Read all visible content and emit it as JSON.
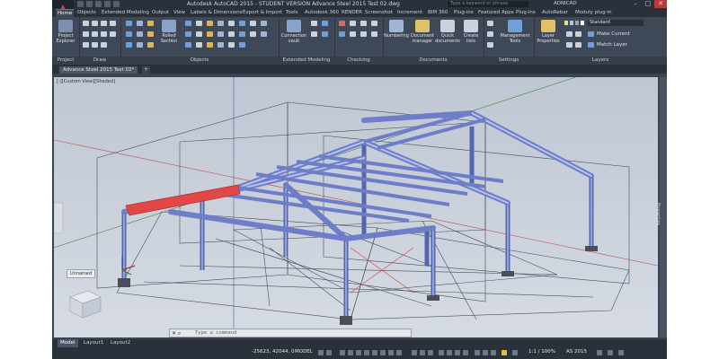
{
  "window": {
    "title": "Autodesk AutoCAD 2015 - STUDENT VERSION   Advance Steel 2015 Test 02.dwg",
    "search_placeholder": "Type a keyword or phrase",
    "user": "ADNICAD"
  },
  "ribbon_tabs": [
    "Home",
    "Objects",
    "Extended Modeling",
    "Output",
    "View",
    "Labels & Dimensions",
    "Export & Import",
    "Tools",
    "Autodesk 360",
    "RENDER",
    "Screenshot",
    "Increment",
    "BIM 360",
    "Plug-ins",
    "Featured Apps",
    "Plug-ins",
    "AutoRebar",
    "Moduly plug-in"
  ],
  "ribbon": {
    "project_explorer": "Project Explorer",
    "project_label": "Project",
    "draw_label": "Draw",
    "rolled_section": "Rolled Section",
    "objects_label": "Objects",
    "connection_vault": "Connection vault",
    "extended_modeling_label": "Extended Modeling",
    "checking_label": "Checking",
    "numbering": "Numbering",
    "document_manager": "Document manager",
    "quick_documents": "Quick documents",
    "create_lists": "Create lists",
    "documents_label": "Documents",
    "management_tools": "Management Tools",
    "settings_label": "Settings",
    "layer_properties": "Layer Properties",
    "layer_name": "Standard",
    "make_current": "Make Current",
    "match_layer": "Match Layer",
    "layers_label": "Layers"
  },
  "document_tab": "Advance Steel 2015 Test 02*",
  "viewport": {
    "label": "[-][Custom View][Shaded]",
    "unnamed": "Unnamed",
    "properties": "Properties"
  },
  "command_prompt": "Type a command",
  "layout_tabs": [
    "Model",
    "Layout1",
    "Layout2"
  ],
  "status": {
    "coords": "-25623, 42044, 0",
    "model": "MODEL",
    "scale": "1:1 / 100%",
    "as": "AS 2015"
  },
  "colors": {
    "ribbon": "#3f4857",
    "viewport": "#c4cbd6",
    "highlight": "#d83a3a",
    "beam": "#8f9fd6"
  }
}
